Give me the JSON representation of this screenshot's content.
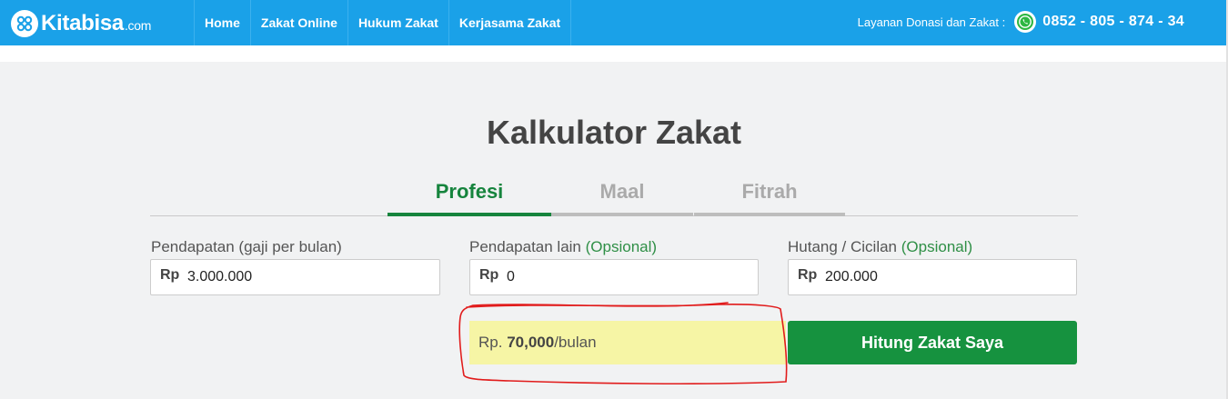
{
  "brand": {
    "name": "Kitabisa",
    "suffix": ".com",
    "color": "#1aa1e8"
  },
  "nav": {
    "items": [
      "Home",
      "Zakat Online",
      "Hukum Zakat",
      "Kerjasama Zakat"
    ]
  },
  "contact": {
    "label": "Layanan Donasi dan Zakat :",
    "phone": "0852 - 805 - 874 - 34",
    "icon": "whatsapp-icon"
  },
  "calculator": {
    "title": "Kalkulator Zakat",
    "tabs": [
      {
        "label": "Profesi",
        "active": true
      },
      {
        "label": "Maal",
        "active": false
      },
      {
        "label": "Fitrah",
        "active": false
      }
    ],
    "fields": [
      {
        "label": "Pendapatan (gaji per bulan)",
        "optional_text": "",
        "prefix": "Rp",
        "value": "3.000.000"
      },
      {
        "label": "Pendapatan lain",
        "optional_text": "(Opsional)",
        "prefix": "Rp",
        "value": "0"
      },
      {
        "label": "Hutang / Cicilan",
        "optional_text": "(Opsional)",
        "prefix": "Rp",
        "value": "200.000"
      }
    ],
    "result": {
      "prefix": "Rp.",
      "amount": "70,000",
      "suffix": "/bulan"
    },
    "submit_label": "Hitung Zakat Saya"
  },
  "colors": {
    "accent_green": "#16843d",
    "button_green": "#16923f",
    "result_highlight": "#f6f5a5",
    "annotation_red": "#e11b1b"
  }
}
